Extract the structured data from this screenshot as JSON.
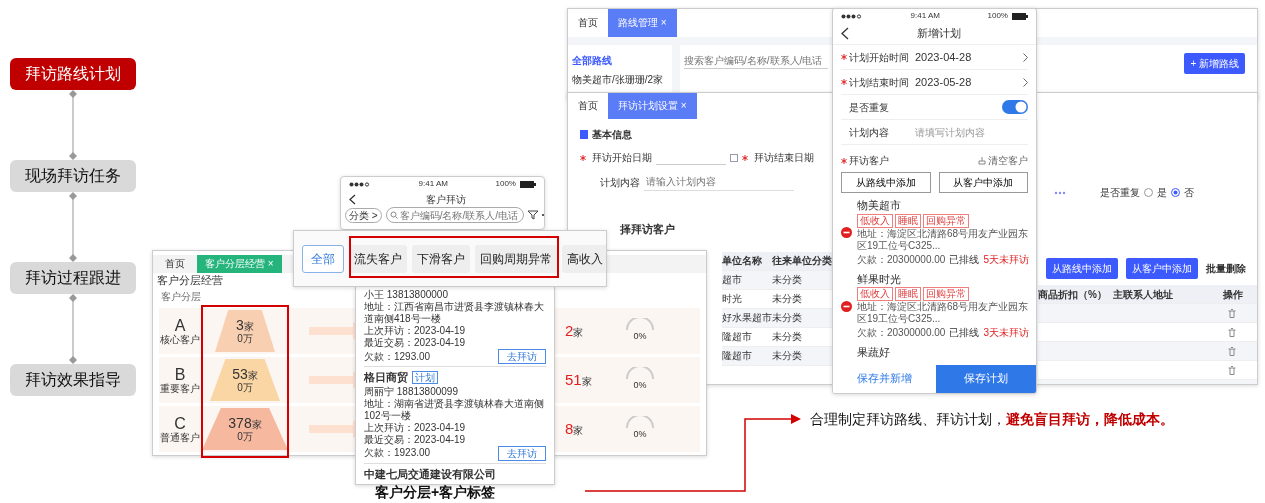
{
  "steps": [
    {
      "label": "拜访路线计划",
      "selected": true
    },
    {
      "label": "现场拜访任务",
      "selected": false
    },
    {
      "label": "拜访过程跟进",
      "selected": false
    },
    {
      "label": "拜访效果指导",
      "selected": false
    }
  ],
  "layering_screen": {
    "tabs": [
      {
        "label": "首页",
        "selected": false
      },
      {
        "label": "客户分层经营 ×",
        "selected": true
      }
    ],
    "title": "客户分层经营",
    "section": "客户分层",
    "tiers": [
      {
        "letter": "A",
        "name": "核心客户",
        "count": "3",
        "unit": "家",
        "amount": "0万",
        "overdue": "2",
        "overdue_unit": "家",
        "gauge": "0%"
      },
      {
        "letter": "B",
        "name": "重要客户",
        "count": "53",
        "unit": "家",
        "amount": "0万",
        "overdue": "51",
        "overdue_unit": "家",
        "gauge": "0%"
      },
      {
        "letter": "C",
        "name": "普通客户",
        "count": "378",
        "unit": "家",
        "amount": "0万",
        "overdue": "8",
        "overdue_unit": "家",
        "gauge": "0%"
      }
    ]
  },
  "visit_phone": {
    "time": "9:41 AM",
    "battery": "100%",
    "title": "客户拜访",
    "filter": "分类 >",
    "search_placeholder": "客户编码/名称/联系人/电话"
  },
  "chips": [
    {
      "label": "全部",
      "selected": true
    },
    {
      "label": "流失客户",
      "selected": false
    },
    {
      "label": "下滑客户",
      "selected": false
    },
    {
      "label": "回购周期异常",
      "selected": false
    },
    {
      "label": "高收入",
      "selected": false
    }
  ],
  "customer_list": [
    {
      "contact": "小王 13813800000",
      "address": "地址：江西省南昌市进贤县李渡镇林春大道南侧418号一楼",
      "last_visit": "上次拜访：2023-04-19",
      "last_trade": "最近交易：2023-04-19",
      "debt": "欠款：1293.00",
      "button": "去拜访"
    },
    {
      "name": "格日商贸",
      "tag": "计划",
      "contact": "周丽宁 18813800099",
      "address": "地址：湖南省进贤县李渡镇林春大道南侧102号一楼",
      "last_visit": "上次拜访：2023-04-19",
      "last_trade": "最近交易：2023-04-19",
      "debt": "欠款：1923.00",
      "button": "去拜访"
    },
    {
      "name": "中建七局交通建设有限公司"
    }
  ],
  "route_screen": {
    "tabs": [
      {
        "label": "首页",
        "selected": false
      },
      {
        "label": "路线管理 ×",
        "selected": true
      }
    ],
    "sidebar_title": "全部路线",
    "sidebar_item": "物美超市/张珊珊/2家",
    "search_placeholder": "搜索客户编码/名称/联系人/电话",
    "add_button": "+ 新增路线"
  },
  "plan_screen": {
    "tabs": [
      {
        "label": "首页",
        "selected": false
      },
      {
        "label": "拜访计划设置 ×",
        "selected": true
      }
    ],
    "section": "基本信息",
    "start_label": "拜访开始日期",
    "end_label": "拜访结束日期",
    "content_label": "计划内容",
    "content_placeholder": "请输入计划内容",
    "repeat_label": "是否重复",
    "repeat_options": [
      {
        "label": "是",
        "selected": false
      },
      {
        "label": "否",
        "selected": true
      }
    ],
    "customers_section": "择拜访客户",
    "buttons": [
      "从路线中添加",
      "从客户中添加"
    ],
    "batch_delete": "批量删除",
    "columns": [
      "单位名称",
      "往来单位分类",
      "商品折扣（%）",
      "主联系人地址",
      "操作"
    ],
    "rows": [
      {
        "name": "超市",
        "category": "未分类"
      },
      {
        "name": "时光",
        "category": "未分类"
      },
      {
        "name": "好水果超市",
        "category": "未分类"
      },
      {
        "name": "隆超市",
        "category": "未分类"
      },
      {
        "name": "隆超市",
        "category": "未分类"
      }
    ]
  },
  "plan_phone": {
    "time": "9:41 AM",
    "battery": "100%",
    "title": "新增计划",
    "fields": [
      {
        "kind": "value",
        "label": "计划开始时间",
        "required": true,
        "value": "2023-04-28"
      },
      {
        "kind": "value",
        "label": "计划结束时间",
        "required": true,
        "value": "2023-05-28"
      },
      {
        "kind": "toggle",
        "label": "是否重复",
        "required": false,
        "on": true
      },
      {
        "kind": "input",
        "label": "计划内容",
        "required": false,
        "placeholder": "请填写计划内容"
      }
    ],
    "customers_label": "拜访客户",
    "clear": "清空客户",
    "add_buttons": [
      "从路线中添加",
      "从客户中添加"
    ],
    "customers": [
      {
        "name": "物美超市",
        "tags": [
          "低收入",
          "睡眠",
          "回购异常"
        ],
        "address": "地址：海淀区北清路68号用友产业园东区19工位号C325...",
        "debt": "欠款：20300000.00",
        "status": "已排线",
        "overdue": "5天未拜访"
      },
      {
        "name": "鲜果时光",
        "tags": [
          "低收入",
          "睡眠",
          "回购异常"
        ],
        "address": "地址：海淀区北清路68号用友产业园东区19工位号C325...",
        "debt": "欠款：20300000.00",
        "status": "已排线",
        "overdue": "3天未拜访"
      },
      {
        "name": "果蔬好"
      }
    ],
    "save_new": "保存并新增",
    "save": "保存计划"
  },
  "caption_right": "合理制定拜访路线、拜访计划，**避免盲目拜访，降低成本。**",
  "caption_bottom": "客户分层+客户标签"
}
